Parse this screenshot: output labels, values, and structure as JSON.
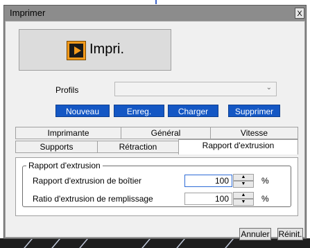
{
  "window": {
    "title": "Imprimer",
    "close_label": "X"
  },
  "print_button": {
    "label": "Impri.",
    "icon": "play-icon",
    "icon_color": "#f49a1b"
  },
  "profiles": {
    "label": "Profils",
    "selected": "",
    "buttons": {
      "new": "Nouveau",
      "save": "Enreg.",
      "load": "Charger",
      "delete": "Supprimer"
    },
    "button_color": "#1457c4"
  },
  "tabs": {
    "row1": [
      "Imprimante",
      "Général",
      "Vitesse"
    ],
    "row2": [
      "Supports",
      "Rétraction",
      "Rapport d'extrusion"
    ],
    "active": "Rapport d'extrusion"
  },
  "panel": {
    "group_title": "Rapport d'extrusion",
    "fields": [
      {
        "label": "Rapport d'extrusion de boîtier",
        "value": "100",
        "unit": "%"
      },
      {
        "label": "Ratio d'extrusion de remplissage",
        "value": "100",
        "unit": "%"
      }
    ]
  },
  "footer": {
    "cancel": "Annuler",
    "reset": "Réinit."
  }
}
